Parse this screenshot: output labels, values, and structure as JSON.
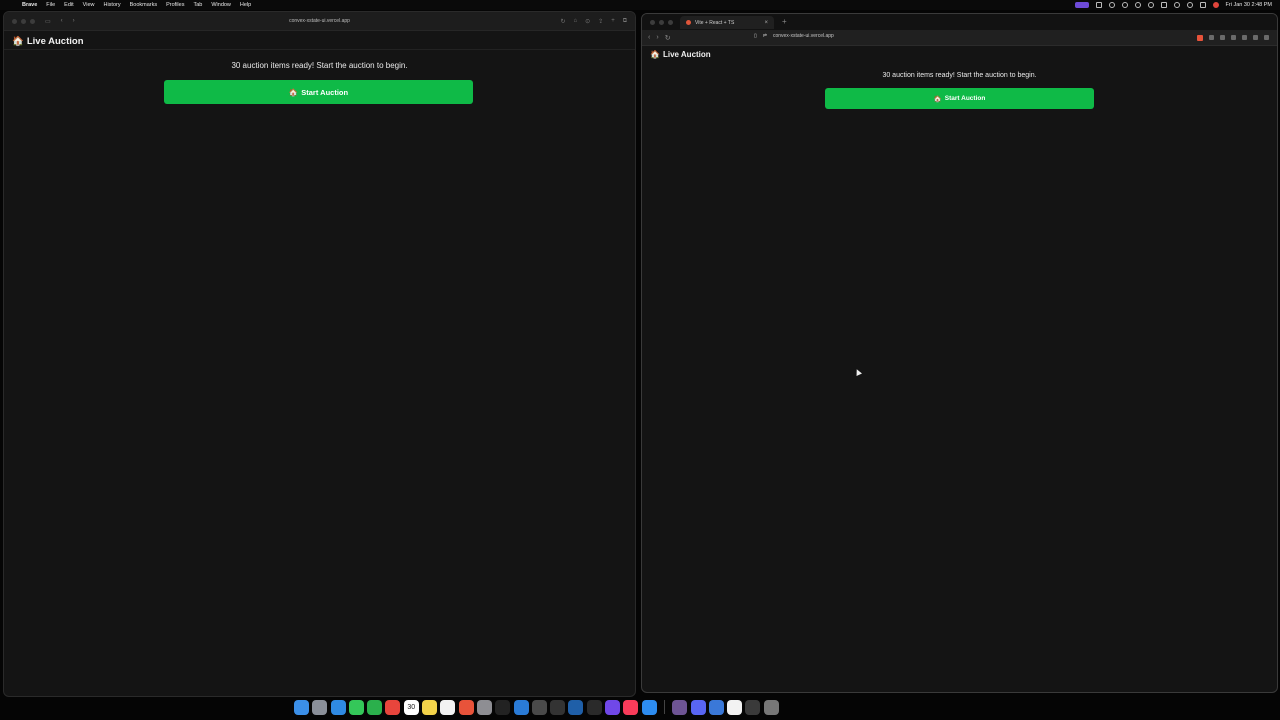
{
  "menubar": {
    "app_name": "Brave",
    "menus": [
      "File",
      "Edit",
      "View",
      "History",
      "Bookmarks",
      "Profiles",
      "Tab",
      "Window",
      "Help"
    ],
    "clock": "Fri Jan 30  2:48 PM"
  },
  "left_window": {
    "address": "convex-xstate-ui.vercel.app",
    "page": {
      "header_icon": "🏠",
      "header_title": "Live Auction",
      "message": "30 auction items ready! Start the auction to begin.",
      "button_icon": "🏠",
      "button_label": "Start Auction"
    }
  },
  "right_window": {
    "tab_title": "Vite + React + TS",
    "address": "convex-xstate-ui.vercel.app",
    "page": {
      "header_icon": "🏠",
      "header_title": "Live Auction",
      "message": "30 auction items ready! Start the auction to begin.",
      "button_icon": "🏠",
      "button_label": "Start Auction"
    }
  },
  "dock": {
    "icons": [
      "finder",
      "launchpad",
      "safari",
      "messages",
      "facetime",
      "chrome",
      "calendar",
      "notes",
      "reminders",
      "brave",
      "settings",
      "terminal",
      "vscode",
      "xcode",
      "slack",
      "arc",
      "notion",
      "figma",
      "music",
      "appstore",
      "github",
      "discord",
      "zed",
      "keynote",
      "preview",
      "photos"
    ],
    "calendar_day": "30"
  },
  "colors": {
    "button_green": "#0fba47",
    "page_bg": "#141414"
  }
}
